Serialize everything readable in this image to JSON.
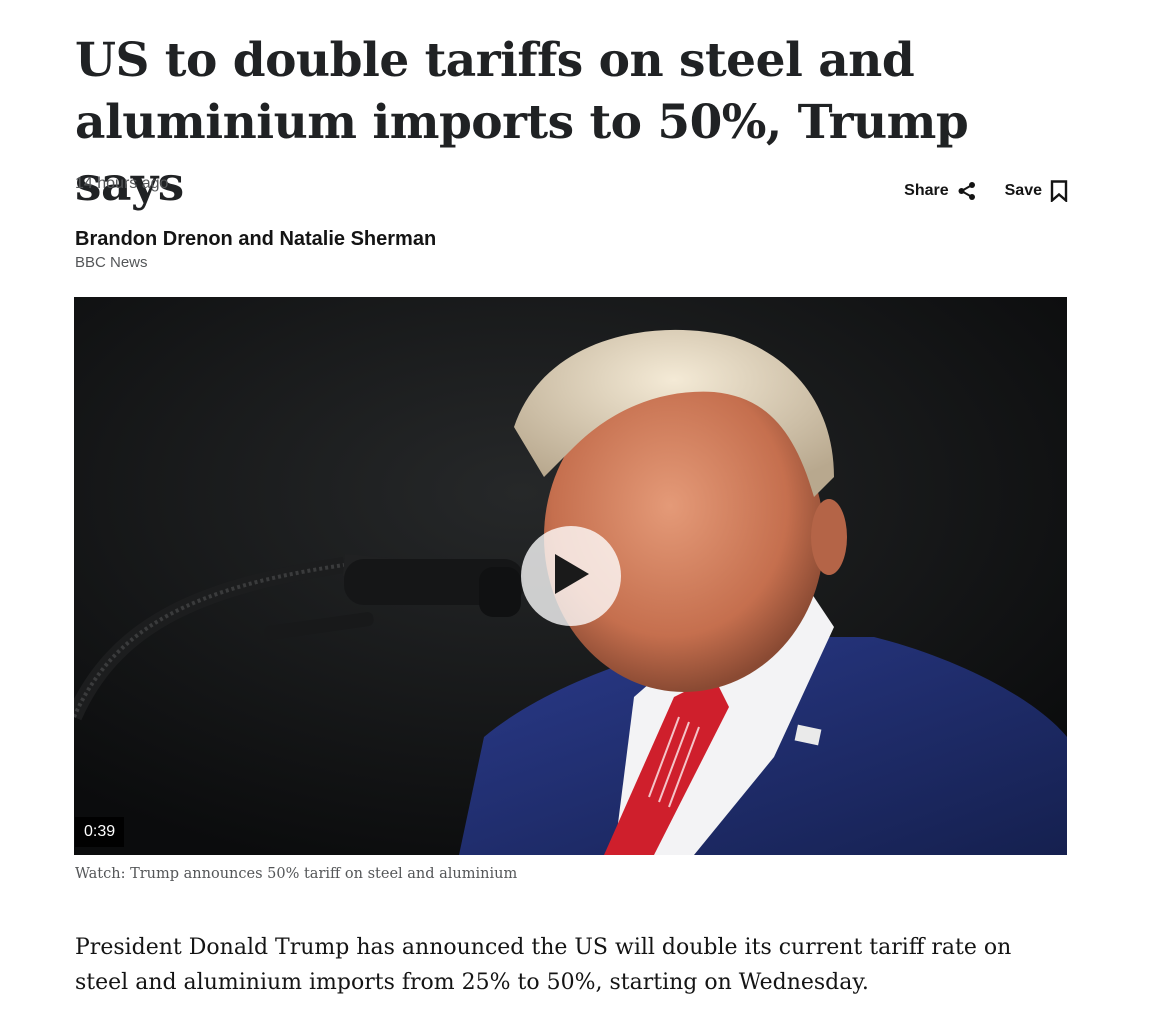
{
  "article": {
    "headline": "US to double tariffs on steel and aluminium imports to 50%, Trump says",
    "timestamp": "14 hours ago",
    "actions": {
      "share_label": "Share",
      "share_icon": "share-icon",
      "save_label": "Save",
      "save_icon": "bookmark-icon"
    },
    "byline": {
      "authors": "Brandon Drenon and Natalie Sherman",
      "organization": "BBC News"
    },
    "video": {
      "duration": "0:39",
      "play_icon": "play-icon",
      "caption": "Watch: Trump announces 50% tariff on steel and aluminium"
    },
    "lede": "President Donald Trump has announced the US will double its current tariff rate on steel and aluminium imports from 25% to 50%, starting on Wednesday."
  }
}
